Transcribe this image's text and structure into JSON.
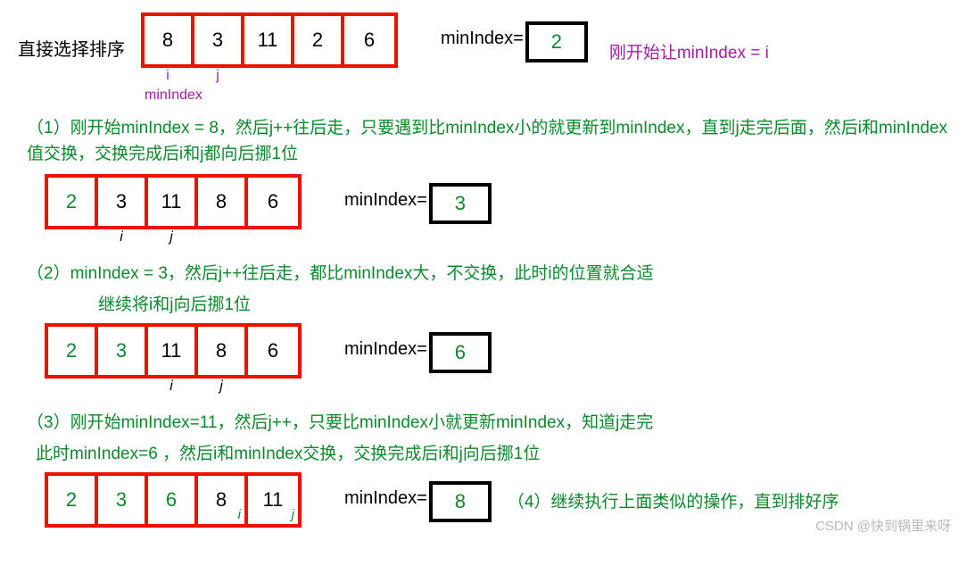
{
  "title": "直接选择排序",
  "step0": {
    "cells": [
      "8",
      "3",
      "11",
      "2",
      "6"
    ],
    "i_label": "i",
    "j_label": "j",
    "minIndex_label": "minIndex",
    "min_text_label": "minIndex=",
    "min_value": "2",
    "comment_right": "刚开始让minIndex = i"
  },
  "desc1": "（1）刚开始minIndex = 8，然后j++往后走，只要遇到比minIndex小的就更新到minIndex，直到j走完后面，然后i和minIndex值交换，交换完成后i和j都向后挪1位",
  "step1": {
    "cells": [
      "2",
      "3",
      "11",
      "8",
      "6"
    ],
    "i_label": "i",
    "j_label": "j",
    "min_text_label": "minIndex=",
    "min_value": "3"
  },
  "desc2_line1": "（2）minIndex = 3，然后j++往后走，都比minIndex大，不交换，此时i的位置就合适",
  "desc2_line2": "继续将i和j向后挪1位",
  "step2": {
    "cells": [
      "2",
      "3",
      "11",
      "8",
      "6"
    ],
    "i_label": "i",
    "j_label": "j",
    "min_text_label": "minIndex=",
    "min_value": "6"
  },
  "desc3_line1": "（3）刚开始minIndex=11，然后j++，只要比minIndex小就更新minIndex，知道j走完",
  "desc3_line2": "此时minIndex=6 ，然后i和minIndex交换，交换完成后i和j向后挪1位",
  "step3": {
    "cells": [
      "2",
      "3",
      "6",
      "8",
      "11"
    ],
    "i_label": "i",
    "j_label": "j",
    "min_text_label": "minIndex=",
    "min_value": "8",
    "comment_right": "（4）继续执行上面类似的操作，直到排好序"
  },
  "watermark": "CSDN @快到锅里来呀"
}
